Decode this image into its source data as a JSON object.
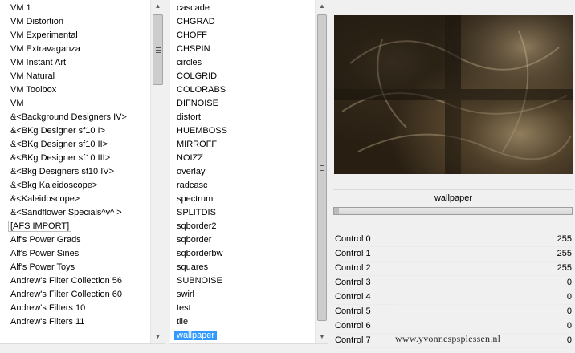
{
  "left_list": {
    "items": [
      "VM 1",
      "VM Distortion",
      "VM Experimental",
      "VM Extravaganza",
      "VM Instant Art",
      "VM Natural",
      "VM Toolbox",
      "VM",
      "&<Background Designers IV>",
      "&<BKg Designer sf10 I>",
      "&<BKg Designer sf10 II>",
      "&<BKg Designer sf10 III>",
      "&<Bkg Designers sf10 IV>",
      "&<Bkg Kaleidoscope>",
      "&<Kaleidoscope>",
      "&<Sandflower Specials^v^ >",
      "[AFS IMPORT]",
      "Alf's Power Grads",
      "Alf's Power Sines",
      "Alf's Power Toys",
      "Andrew's Filter Collection 56",
      "Andrew's Filter Collection 60",
      "Andrew's Filters 10",
      "Andrew's Filters 11"
    ],
    "boxed_index": 16
  },
  "middle_list": {
    "items": [
      "cascade",
      "CHGRAD",
      "CHOFF",
      "CHSPIN",
      "circles",
      "COLGRID",
      "COLORABS",
      "DIFNOISE",
      "distort",
      "HUEMBOSS",
      "MIRROFF",
      "NOIZZ",
      "overlay",
      "radcasc",
      "spectrum",
      "SPLITDIS",
      "sqborder2",
      "sqborder",
      "sqborderbw",
      "squares",
      "SUBNOISE",
      "swirl",
      "test",
      "tile",
      "wallpaper"
    ],
    "selected_index": 24
  },
  "preview": {
    "filter_name": "wallpaper",
    "colors": {
      "dark": "#2e2417",
      "mid": "#6b5a41",
      "light": "#c9b48e"
    }
  },
  "progress": {
    "fraction": 0.02
  },
  "controls": [
    {
      "name": "Control 0",
      "value": "255"
    },
    {
      "name": "Control 1",
      "value": "255"
    },
    {
      "name": "Control 2",
      "value": "255"
    },
    {
      "name": "Control 3",
      "value": "0"
    },
    {
      "name": "Control 4",
      "value": "0"
    },
    {
      "name": "Control 5",
      "value": "0"
    },
    {
      "name": "Control 6",
      "value": "0"
    },
    {
      "name": "Control 7",
      "value": "0"
    }
  ],
  "watermark": "www.yvonnespsplessen.nl",
  "icons": {
    "scroll_up": "triangle-up",
    "scroll_down": "triangle-down",
    "grip": "thumb-grip"
  }
}
